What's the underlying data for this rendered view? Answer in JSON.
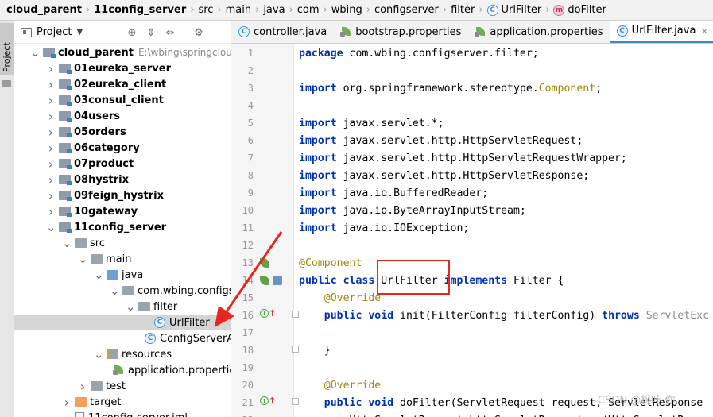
{
  "breadcrumb": {
    "items": [
      {
        "label": "cloud_parent",
        "bold": true
      },
      {
        "label": "11config_server",
        "bold": true
      },
      {
        "label": "src"
      },
      {
        "label": "main"
      },
      {
        "label": "java"
      },
      {
        "label": "com"
      },
      {
        "label": "wbing"
      },
      {
        "label": "configserver"
      },
      {
        "label": "filter"
      },
      {
        "label": "UrlFilter",
        "icon": "class-c"
      },
      {
        "label": "doFilter",
        "icon": "method-m"
      }
    ]
  },
  "toolstrip": {
    "project_tab_label": "Project"
  },
  "project_panel": {
    "title": "Project",
    "tree": [
      {
        "label": "cloud_parent",
        "path": "E:\\wbing\\springcloud\\clo",
        "kind": "module",
        "arrow": "down",
        "bold": true
      },
      {
        "label": "01eureka_server",
        "kind": "module",
        "arrow": "right",
        "bold": true
      },
      {
        "label": "02eureka_client",
        "kind": "module",
        "arrow": "right",
        "bold": true
      },
      {
        "label": "03consul_client",
        "kind": "module",
        "arrow": "right",
        "bold": true
      },
      {
        "label": "04users",
        "kind": "module",
        "arrow": "right",
        "bold": true
      },
      {
        "label": "05orders",
        "kind": "module",
        "arrow": "right",
        "bold": true
      },
      {
        "label": "06category",
        "kind": "module",
        "arrow": "right",
        "bold": true
      },
      {
        "label": "07product",
        "kind": "module",
        "arrow": "right",
        "bold": true
      },
      {
        "label": "08hystrix",
        "kind": "module",
        "arrow": "right",
        "bold": true
      },
      {
        "label": "09feign_hystrix",
        "kind": "module",
        "arrow": "right",
        "bold": true
      },
      {
        "label": "10gateway",
        "kind": "module",
        "arrow": "right",
        "bold": true
      },
      {
        "label": "11config_server",
        "kind": "module",
        "arrow": "down",
        "bold": true
      },
      {
        "label": "src",
        "kind": "dir",
        "arrow": "down"
      },
      {
        "label": "main",
        "kind": "dir",
        "arrow": "down"
      },
      {
        "label": "java",
        "kind": "dir-src",
        "arrow": "down"
      },
      {
        "label": "com.wbing.configserve",
        "kind": "dir",
        "arrow": "down"
      },
      {
        "label": "filter",
        "kind": "dir",
        "arrow": "down"
      },
      {
        "label": "UrlFilter",
        "kind": "class",
        "arrow": "",
        "selected": true
      },
      {
        "label": "ConfigServerApplic",
        "kind": "class",
        "arrow": ""
      },
      {
        "label": "resources",
        "kind": "dir-res",
        "arrow": "down"
      },
      {
        "label": "application.properties",
        "kind": "leaf",
        "arrow": ""
      },
      {
        "label": "test",
        "kind": "dir",
        "arrow": "right"
      },
      {
        "label": "target",
        "kind": "dir-target",
        "arrow": "right"
      },
      {
        "label": "11config-server.iml",
        "kind": "file",
        "arrow": ""
      }
    ]
  },
  "tabs": [
    {
      "label": "controller.java",
      "icon": "class-c",
      "active": false
    },
    {
      "label": "bootstrap.properties",
      "icon": "leaf",
      "active": false
    },
    {
      "label": "application.properties",
      "icon": "leaf",
      "active": false
    },
    {
      "label": "UrlFilter.java",
      "icon": "class-c",
      "active": true,
      "close": "×"
    }
  ],
  "editor": {
    "lines": [
      {
        "n": "1",
        "code": [
          {
            "t": "package",
            "c": "kw"
          },
          {
            "t": " com.wbing.configserver.filter;"
          }
        ]
      },
      {
        "n": "2",
        "code": []
      },
      {
        "n": "3",
        "code": [
          {
            "t": "import",
            "c": "kw"
          },
          {
            "t": " org.springframework.stereotype."
          },
          {
            "t": "Component",
            "c": "cmp"
          },
          {
            "t": ";"
          }
        ]
      },
      {
        "n": "4",
        "code": []
      },
      {
        "n": "5",
        "code": [
          {
            "t": "import",
            "c": "kw"
          },
          {
            "t": " javax.servlet.*;"
          }
        ]
      },
      {
        "n": "6",
        "code": [
          {
            "t": "import",
            "c": "kw"
          },
          {
            "t": " javax.servlet.http.HttpServletRequest;"
          }
        ]
      },
      {
        "n": "7",
        "code": [
          {
            "t": "import",
            "c": "kw"
          },
          {
            "t": " javax.servlet.http.HttpServletRequestWrapper;"
          }
        ]
      },
      {
        "n": "8",
        "code": [
          {
            "t": "import",
            "c": "kw"
          },
          {
            "t": " javax.servlet.http.HttpServletResponse;"
          }
        ]
      },
      {
        "n": "9",
        "code": [
          {
            "t": "import",
            "c": "kw"
          },
          {
            "t": " java.io.BufferedReader;"
          }
        ]
      },
      {
        "n": "10",
        "code": [
          {
            "t": "import",
            "c": "kw"
          },
          {
            "t": " java.io.ByteArrayInputStream;"
          }
        ]
      },
      {
        "n": "11",
        "code": [
          {
            "t": "import",
            "c": "kw"
          },
          {
            "t": " java.io.IOException;"
          }
        ]
      },
      {
        "n": "12",
        "code": []
      },
      {
        "n": "13",
        "code": [
          {
            "t": "@Component",
            "c": "ann"
          }
        ]
      },
      {
        "n": "14",
        "code": [
          {
            "t": "public class",
            "c": "kw"
          },
          {
            "t": " UrlFilter "
          },
          {
            "t": "implements",
            "c": "kw"
          },
          {
            "t": " Filter {"
          }
        ]
      },
      {
        "n": "15",
        "code": [
          {
            "t": "    "
          },
          {
            "t": "@Override",
            "c": "ann"
          }
        ]
      },
      {
        "n": "16",
        "code": [
          {
            "t": "    "
          },
          {
            "t": "public void",
            "c": "kw"
          },
          {
            "t": " init(FilterConfig filterConfig) "
          },
          {
            "t": "throws",
            "c": "kw"
          },
          {
            "t": " "
          },
          {
            "t": "ServletExc",
            "c": "gray"
          }
        ]
      },
      {
        "n": "17",
        "code": []
      },
      {
        "n": "18",
        "code": [
          {
            "t": "    }"
          }
        ]
      },
      {
        "n": "19",
        "code": []
      },
      {
        "n": "20",
        "code": [
          {
            "t": "    "
          },
          {
            "t": "@Override",
            "c": "ann"
          }
        ]
      },
      {
        "n": "21",
        "code": [
          {
            "t": "    "
          },
          {
            "t": "public void",
            "c": "kw"
          },
          {
            "t": " doFilter(ServletRequest request, ServletResponse"
          }
        ]
      },
      {
        "n": "22",
        "code": [
          {
            "t": "        HttpServletRequest httpServletRequest = (HttpServletRe"
          }
        ]
      }
    ]
  },
  "watermark": "CSDN @枫叶·你"
}
